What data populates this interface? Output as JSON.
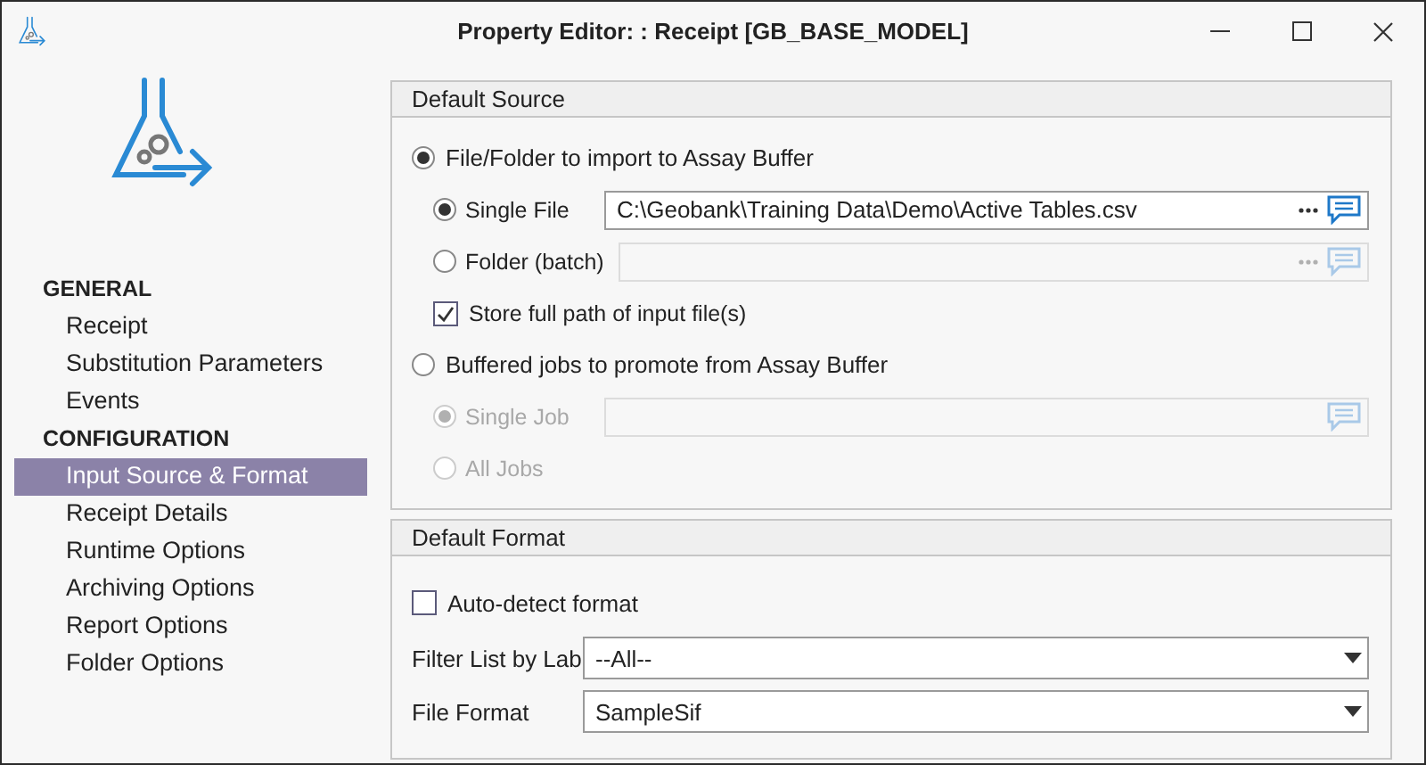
{
  "window": {
    "title": "Property Editor: : Receipt [GB_BASE_MODEL]"
  },
  "sidebar": {
    "sections": [
      {
        "heading": "GENERAL",
        "items": [
          {
            "label": "Receipt",
            "selected": false
          },
          {
            "label": "Substitution Parameters",
            "selected": false
          },
          {
            "label": "Events",
            "selected": false
          }
        ]
      },
      {
        "heading": "CONFIGURATION",
        "items": [
          {
            "label": "Input Source & Format",
            "selected": true
          },
          {
            "label": "Receipt Details",
            "selected": false
          },
          {
            "label": "Runtime Options",
            "selected": false
          },
          {
            "label": "Archiving Options",
            "selected": false
          },
          {
            "label": "Report Options",
            "selected": false
          },
          {
            "label": "Folder Options",
            "selected": false
          }
        ]
      }
    ]
  },
  "default_source": {
    "title": "Default Source",
    "options": [
      {
        "label": "File/Folder to import to Assay Buffer",
        "selected": true,
        "children": [
          {
            "kind": "radio",
            "label": "Single File",
            "selected": true,
            "disabled": false,
            "field": {
              "value": "C:\\Geobank\\Training Data\\Demo\\Active Tables.csv",
              "disabled": false,
              "browse": true
            }
          },
          {
            "kind": "radio",
            "label": "Folder (batch)",
            "selected": false,
            "disabled": false,
            "field": {
              "disabled": true,
              "browse": true
            }
          },
          {
            "kind": "checkbox",
            "label": "Store full path of input file(s)",
            "checked": true
          }
        ]
      },
      {
        "label": "Buffered jobs to promote from Assay Buffer",
        "selected": false,
        "children": [
          {
            "kind": "radio",
            "label": "Single Job",
            "selected": true,
            "disabled": true,
            "field": {
              "disabled": true,
              "browse": false
            }
          },
          {
            "kind": "radio",
            "label": "All Jobs",
            "selected": false,
            "disabled": true
          }
        ]
      }
    ]
  },
  "default_format": {
    "title": "Default Format",
    "auto_detect": {
      "label": "Auto-detect format",
      "checked": false
    },
    "fields": [
      {
        "label": "Filter List by Lab",
        "value": "--All--"
      },
      {
        "label": "File Format",
        "value": "SampleSif"
      }
    ]
  }
}
